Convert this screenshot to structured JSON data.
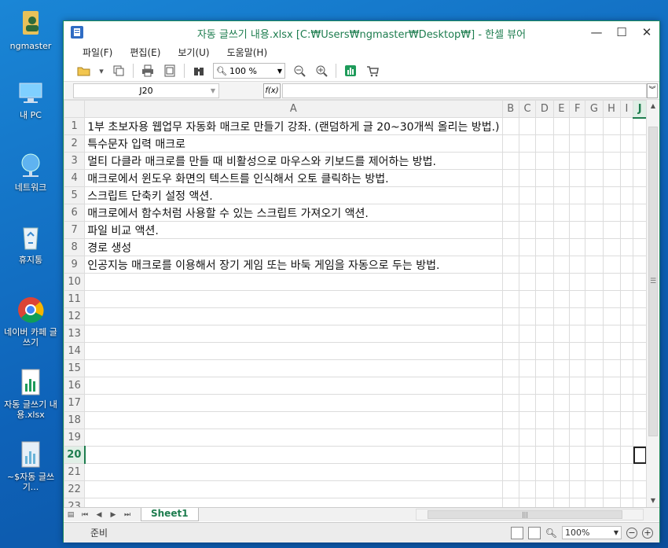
{
  "desktop": {
    "icons": [
      {
        "label": "ngmaster",
        "icon": "user-folder-icon"
      },
      {
        "label": "내 PC",
        "icon": "computer-icon"
      },
      {
        "label": "네트워크",
        "icon": "network-icon"
      },
      {
        "label": "휴지통",
        "icon": "recycle-bin-icon"
      },
      {
        "label": "네이버 카페 글쓰기",
        "icon": "chrome-icon"
      },
      {
        "label": "자동 글쓰기 내용.xlsx",
        "icon": "spreadsheet-file-icon"
      },
      {
        "label": "~$자동 글쓰기...",
        "icon": "spreadsheet-temp-file-icon"
      }
    ]
  },
  "window": {
    "title": "자동 글쓰기 내용.xlsx [C:₩Users₩ngmaster₩Desktop₩] - 한셀 뷰어",
    "controls": {
      "minimize": "—",
      "maximize": "☐",
      "close": "✕"
    }
  },
  "menu": [
    "파일(F)",
    "편집(E)",
    "보기(U)",
    "도움말(H)"
  ],
  "toolbar": {
    "zoom_value": "100 %"
  },
  "formula_bar": {
    "cell_ref": "J20",
    "fx_label": "f(x)",
    "formula": ""
  },
  "grid": {
    "columns": [
      "A",
      "B",
      "C",
      "D",
      "E",
      "F",
      "G",
      "H",
      "I",
      "J"
    ],
    "selected_column": "J",
    "selected_row": "20",
    "rows": [
      {
        "num": "1",
        "text": "1부 초보자용 웹업무 자동화 매크로 만들기 강좌. (랜덤하게 글 20~30개씩 올리는 방법.)"
      },
      {
        "num": "2",
        "text": "특수문자 입력 매크로"
      },
      {
        "num": "3",
        "text": "멀티 다클라 매크로를 만들 때 비활성으로 마우스와 키보드를 제어하는 방법."
      },
      {
        "num": "4",
        "text": "매크로에서 윈도우 화면의 텍스트를 인식해서 오토 클릭하는 방법."
      },
      {
        "num": "5",
        "text": "스크립트 단축키 설정 액션."
      },
      {
        "num": "6",
        "text": "매크로에서 함수처럼 사용할 수 있는 스크립트 가져오기 액션."
      },
      {
        "num": "7",
        "text": "파일 비교 액션."
      },
      {
        "num": "8",
        "text": "경로 생성"
      },
      {
        "num": "9",
        "text": "인공지능 매크로를 이용해서 장기 게임 또는 바둑 게임을 자동으로 두는 방법."
      },
      {
        "num": "10",
        "text": ""
      },
      {
        "num": "11",
        "text": ""
      },
      {
        "num": "12",
        "text": ""
      },
      {
        "num": "13",
        "text": ""
      },
      {
        "num": "14",
        "text": ""
      },
      {
        "num": "15",
        "text": ""
      },
      {
        "num": "16",
        "text": ""
      },
      {
        "num": "17",
        "text": ""
      },
      {
        "num": "18",
        "text": ""
      },
      {
        "num": "19",
        "text": ""
      },
      {
        "num": "20",
        "text": ""
      },
      {
        "num": "21",
        "text": ""
      },
      {
        "num": "22",
        "text": ""
      },
      {
        "num": "23",
        "text": ""
      }
    ]
  },
  "sheet_tabs": [
    "Sheet1"
  ],
  "status": {
    "ready": "준비",
    "zoom": "100%"
  },
  "colors": {
    "accent": "#1e7d4f",
    "desktop": "#0e62b8"
  }
}
